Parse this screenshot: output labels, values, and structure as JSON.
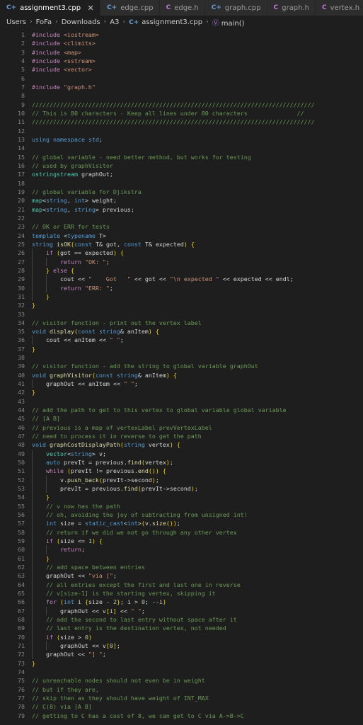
{
  "window": {
    "background": "#1e1e1e",
    "editor_background": "#1e1e1e",
    "tabbar_background": "#252526"
  },
  "tabbar": {
    "tabs": [
      {
        "label": "assignment3.cpp",
        "icon": "cpp-file-icon",
        "icon_glyph": "C+",
        "active": true,
        "close_glyph": "✕"
      },
      {
        "label": "edge.cpp",
        "icon": "cpp-file-icon",
        "icon_glyph": "C+",
        "active": false,
        "close_glyph": ""
      },
      {
        "label": "edge.h",
        "icon": "h-file-icon",
        "icon_glyph": "C",
        "active": false,
        "close_glyph": ""
      },
      {
        "label": "graph.cpp",
        "icon": "cpp-file-icon",
        "icon_glyph": "C+",
        "active": false,
        "close_glyph": ""
      },
      {
        "label": "graph.h",
        "icon": "h-file-icon",
        "icon_glyph": "C",
        "active": false,
        "close_glyph": ""
      },
      {
        "label": "vertex.h",
        "icon": "h-file-icon",
        "icon_glyph": "C",
        "active": false,
        "close_glyph": ""
      }
    ]
  },
  "breadcrumb": {
    "separator": "›",
    "items": [
      {
        "label": "Users",
        "icon": ""
      },
      {
        "label": "FoFa",
        "icon": ""
      },
      {
        "label": "Downloads",
        "icon": ""
      },
      {
        "label": "A3",
        "icon": ""
      },
      {
        "label": "assignment3.cpp",
        "icon": "cpp-file-icon"
      },
      {
        "label": "main()",
        "icon": "method-icon"
      }
    ]
  },
  "editor": {
    "language": "cpp",
    "first_visible_line": 1,
    "last_visible_line": 79,
    "total_visible_lines": 79,
    "lines": [
      {
        "n": 1,
        "text": "#include <iostream>"
      },
      {
        "n": 2,
        "text": "#include <climits>"
      },
      {
        "n": 3,
        "text": "#include <map>"
      },
      {
        "n": 4,
        "text": "#include <sstream>"
      },
      {
        "n": 5,
        "text": "#include <vector>"
      },
      {
        "n": 6,
        "text": ""
      },
      {
        "n": 7,
        "text": "#include \"graph.h\""
      },
      {
        "n": 8,
        "text": ""
      },
      {
        "n": 9,
        "text": "////////////////////////////////////////////////////////////////////////////////"
      },
      {
        "n": 10,
        "text": "// This is 80 characters - Keep all lines under 80 characters              //"
      },
      {
        "n": 11,
        "text": "////////////////////////////////////////////////////////////////////////////////"
      },
      {
        "n": 12,
        "text": ""
      },
      {
        "n": 13,
        "text": "using namespace std;"
      },
      {
        "n": 14,
        "text": ""
      },
      {
        "n": 15,
        "text": "// global variable - need better method, but works for testing"
      },
      {
        "n": 16,
        "text": "// used by graphVisitor"
      },
      {
        "n": 17,
        "text": "ostringstream graphOut;"
      },
      {
        "n": 18,
        "text": ""
      },
      {
        "n": 19,
        "text": "// global variable for Djikstra"
      },
      {
        "n": 20,
        "text": "map<string, int> weight;"
      },
      {
        "n": 21,
        "text": "map<string, string> previous;"
      },
      {
        "n": 22,
        "text": ""
      },
      {
        "n": 23,
        "text": "// OK or ERR for tests"
      },
      {
        "n": 24,
        "text": "template <typename T>"
      },
      {
        "n": 25,
        "text": "string isOK(const T& got, const T& expected) {"
      },
      {
        "n": 26,
        "text": "    if (got == expected) {"
      },
      {
        "n": 27,
        "text": "        return \"OK: \";"
      },
      {
        "n": 28,
        "text": "    } else {"
      },
      {
        "n": 29,
        "text": "        cout << \"    Got   \" << got << \"\\n expected \" << expected << endl;"
      },
      {
        "n": 30,
        "text": "        return \"ERR: \";"
      },
      {
        "n": 31,
        "text": "    }"
      },
      {
        "n": 32,
        "text": "}"
      },
      {
        "n": 33,
        "text": ""
      },
      {
        "n": 34,
        "text": "// visitor function - print out the vertex label"
      },
      {
        "n": 35,
        "text": "void display(const string& anItem) {"
      },
      {
        "n": 36,
        "text": "    cout << anItem << \" \";"
      },
      {
        "n": 37,
        "text": "}"
      },
      {
        "n": 38,
        "text": ""
      },
      {
        "n": 39,
        "text": "// visitor function - add the string to global variable graphOut"
      },
      {
        "n": 40,
        "text": "void graphVisitor(const string& anItem) {"
      },
      {
        "n": 41,
        "text": "    graphOut << anItem << \" \";"
      },
      {
        "n": 42,
        "text": "}"
      },
      {
        "n": 43,
        "text": ""
      },
      {
        "n": 44,
        "text": "// add the path to get to this vertex to global variable global variable"
      },
      {
        "n": 45,
        "text": "// [A B]"
      },
      {
        "n": 46,
        "text": "// previous is a map of vertexLabel prevVertexLabel"
      },
      {
        "n": 47,
        "text": "// need to process it in reverse to get the path"
      },
      {
        "n": 48,
        "text": "void graphCostDisplayPath(string vertex) {"
      },
      {
        "n": 49,
        "text": "    vector<string> v;"
      },
      {
        "n": 50,
        "text": "    auto prevIt = previous.find(vertex);"
      },
      {
        "n": 51,
        "text": "    while (prevIt != previous.end()) {"
      },
      {
        "n": 52,
        "text": "        v.push_back(prevIt->second);"
      },
      {
        "n": 53,
        "text": "        prevIt = previous.find(prevIt->second);"
      },
      {
        "n": 54,
        "text": "    }"
      },
      {
        "n": 55,
        "text": "    // v now has the path"
      },
      {
        "n": 56,
        "text": "    // oh, avoiding the joy of subtracting from unsigned int!"
      },
      {
        "n": 57,
        "text": "    int size = static_cast<int>(v.size());"
      },
      {
        "n": 58,
        "text": "    // return if we did we not go through any other vertex"
      },
      {
        "n": 59,
        "text": "    if (size <= 1) {"
      },
      {
        "n": 60,
        "text": "        return;"
      },
      {
        "n": 61,
        "text": "    }"
      },
      {
        "n": 62,
        "text": "    // add space between entries"
      },
      {
        "n": 63,
        "text": "    graphOut << \"via [\";"
      },
      {
        "n": 64,
        "text": "    // all entries except the first and last one in reverse"
      },
      {
        "n": 65,
        "text": "    // v[size-1] is the starting vertex, skipping it"
      },
      {
        "n": 66,
        "text": "    for (int i {size - 2}; i > 0; --i)"
      },
      {
        "n": 67,
        "text": "        graphOut << v[i] << \" \";"
      },
      {
        "n": 68,
        "text": "    // add the second to last entry without space after it"
      },
      {
        "n": 69,
        "text": "    // last entry is the destination vertex, not needed"
      },
      {
        "n": 70,
        "text": "    if (size > 0)"
      },
      {
        "n": 71,
        "text": "        graphOut << v[0];"
      },
      {
        "n": 72,
        "text": "    graphOut << \"] \";"
      },
      {
        "n": 73,
        "text": "}"
      },
      {
        "n": 74,
        "text": ""
      },
      {
        "n": 75,
        "text": "// unreachable nodes should not even be in weight"
      },
      {
        "n": 76,
        "text": "// but if they are,"
      },
      {
        "n": 77,
        "text": "// skip then as they should have weight of INT_MAX"
      },
      {
        "n": 78,
        "text": "// C(8) via [A B]"
      },
      {
        "n": 79,
        "text": "// getting to C has a cost of 8, we can get to C via A->B->C"
      }
    ]
  },
  "colors": {
    "comment": "#6a9955",
    "keyword": "#569cd6",
    "control_keyword": "#c586c0",
    "string": "#ce9178",
    "number": "#b5cea8",
    "function": "#dcdcaa",
    "type": "#4ec9b0",
    "variable": "#9cdcfe",
    "plain": "#d4d4d4",
    "line_number": "#858585",
    "background": "#1e1e1e"
  }
}
